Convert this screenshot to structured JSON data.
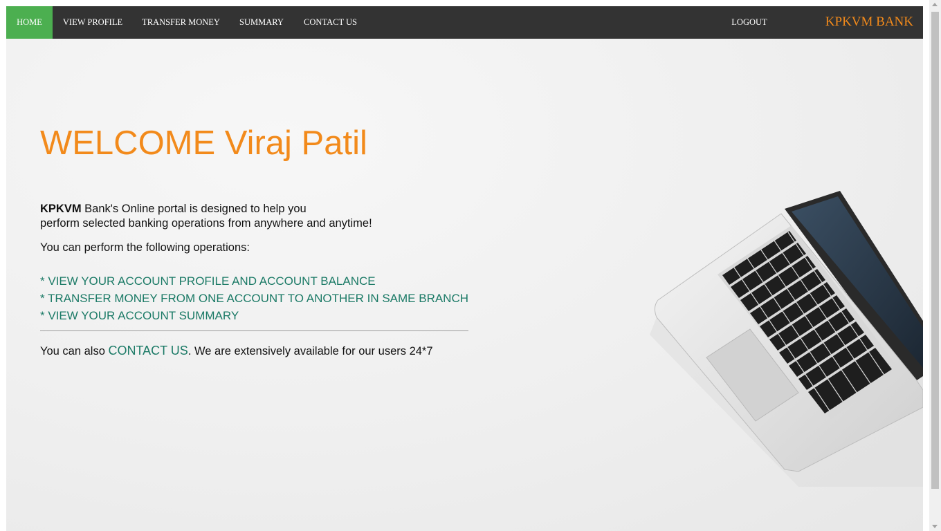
{
  "nav": {
    "items": [
      {
        "label": "HOME",
        "active": true
      },
      {
        "label": "VIEW PROFILE",
        "active": false
      },
      {
        "label": "TRANSFER MONEY",
        "active": false
      },
      {
        "label": "SUMMARY",
        "active": false
      },
      {
        "label": "CONTACT US",
        "active": false
      }
    ],
    "logout": "LOGOUT",
    "brand": "KPKVM BANK"
  },
  "main": {
    "welcome": "WELCOME Viraj Patil",
    "intro_bold": "KPKVM",
    "intro_line1": " Bank's Online portal is designed to help you",
    "intro_line2": "perform selected banking operations from anywhere and anytime!",
    "ops_intro": "You can perform the following operations:",
    "operations": [
      "* VIEW YOUR ACCOUNT PROFILE AND ACCOUNT BALANCE",
      "* TRANSFER MONEY FROM ONE ACCOUNT TO ANOTHER IN SAME BRANCH",
      "* VIEW YOUR ACCOUNT SUMMARY"
    ],
    "contact_prefix": "You can also ",
    "contact_link": "CONTACT US",
    "contact_suffix": ". We are extensively available for our users 24*7"
  },
  "colors": {
    "accent": "#f28a1b",
    "nav_active": "#4caf50",
    "nav_bg": "#333333",
    "link": "#1b7a66"
  },
  "image": {
    "icon": "laptop-icon"
  }
}
